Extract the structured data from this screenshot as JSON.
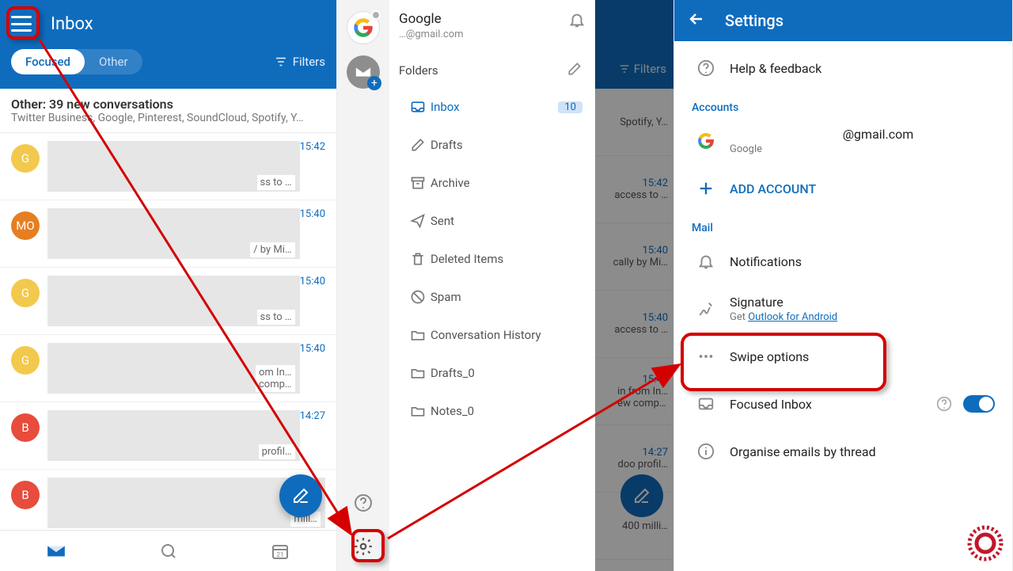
{
  "screen1": {
    "title": "Inbox",
    "tabs": {
      "focused": "Focused",
      "other": "Other"
    },
    "filters": "Filters",
    "otherHeader": {
      "title": "Other: 39 new conversations",
      "sub": "Twitter Business, Google, Pinterest, SoundCloud, Spotify, Y…"
    },
    "emails": [
      {
        "initial": "G",
        "color": "#f2c94c",
        "time": "15:42",
        "snip": "ss to …"
      },
      {
        "initial": "MO",
        "color": "#e67e22",
        "time": "15:40",
        "snip": "/ by Mi…"
      },
      {
        "initial": "G",
        "color": "#f2c94c",
        "time": "15:40",
        "snip": "ss to …"
      },
      {
        "initial": "G",
        "color": "#f2c94c",
        "time": "15:40",
        "snip": "om In…\ncomp…"
      },
      {
        "initial": "B",
        "color": "#e74c3c",
        "time": "14:27",
        "snip": "profil…"
      },
      {
        "initial": "B",
        "color": "#e74c3c",
        "time": "",
        "snip": "mill…"
      }
    ]
  },
  "screen2": {
    "account": {
      "name": "Google",
      "email": "…@gmail.com"
    },
    "foldersTitle": "Folders",
    "inboxBadge": "10",
    "folders": [
      {
        "label": "Inbox",
        "active": true,
        "badge": true
      },
      {
        "label": "Drafts"
      },
      {
        "label": "Archive"
      },
      {
        "label": "Sent"
      },
      {
        "label": "Deleted Items"
      },
      {
        "label": "Spam"
      },
      {
        "label": "Conversation History"
      },
      {
        "label": "Drafts_0"
      },
      {
        "label": "Notes_0"
      }
    ],
    "filters": "Filters",
    "peek": [
      {
        "time": "",
        "sub": "Spotify, Y…"
      },
      {
        "time": "15:42",
        "sub": "access to …"
      },
      {
        "time": "15:40",
        "sub": "cally by Mi…"
      },
      {
        "time": "15:40",
        "sub": "access to …"
      },
      {
        "time": "15:40",
        "sub": "in from In…\new comp…"
      },
      {
        "time": "14:27",
        "sub": "doo profil…"
      },
      {
        "time": "",
        "sub": "400 milli…"
      }
    ]
  },
  "screen3": {
    "title": "Settings",
    "help": "Help & feedback",
    "sections": {
      "accounts": "Accounts",
      "mail": "Mail"
    },
    "account": {
      "email": "@gmail.com",
      "provider": "Google"
    },
    "addAccount": "ADD ACCOUNT",
    "notifications": "Notifications",
    "signature": {
      "title": "Signature",
      "subPrefix": "Get ",
      "subLink": "Outlook for Android"
    },
    "swipe": "Swipe options",
    "focused": "Focused Inbox",
    "organise": "Organise emails by thread"
  },
  "icons": {
    "mail": "mail",
    "add": "+"
  }
}
